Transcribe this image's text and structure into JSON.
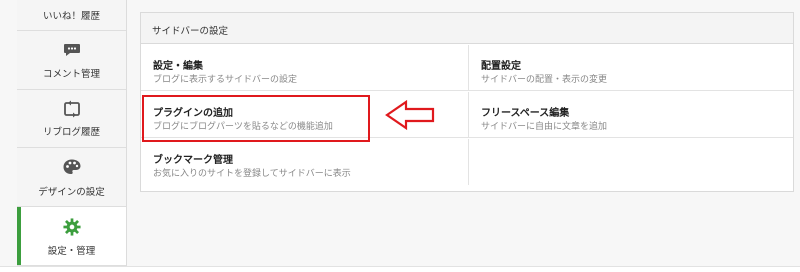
{
  "sidebar": {
    "items": [
      {
        "label": "いいね！履歴",
        "icon": "heart-icon"
      },
      {
        "label": "コメント管理",
        "icon": "comment-icon"
      },
      {
        "label": "リブログ履歴",
        "icon": "reblog-icon"
      },
      {
        "label": "デザインの設定",
        "icon": "palette-icon"
      },
      {
        "label": "設定・管理",
        "icon": "gear-icon",
        "active": true
      }
    ]
  },
  "panel": {
    "title": "サイドバーの設定",
    "items": [
      {
        "title": "設定・編集",
        "desc": "ブログに表示するサイドバーの設定"
      },
      {
        "title": "配置設定",
        "desc": "サイドバーの配置・表示の変更"
      },
      {
        "title": "プラグインの追加",
        "desc": "ブログにブログパーツを貼るなどの機能追加"
      },
      {
        "title": "フリースペース編集",
        "desc": "サイドバーに自由に文章を追加"
      },
      {
        "title": "ブックマーク管理",
        "desc": "お気に入りのサイトを登録してサイドバーに表示"
      }
    ]
  },
  "colors": {
    "accent_green": "#3c9e3e",
    "highlight_red": "#e0191d"
  }
}
